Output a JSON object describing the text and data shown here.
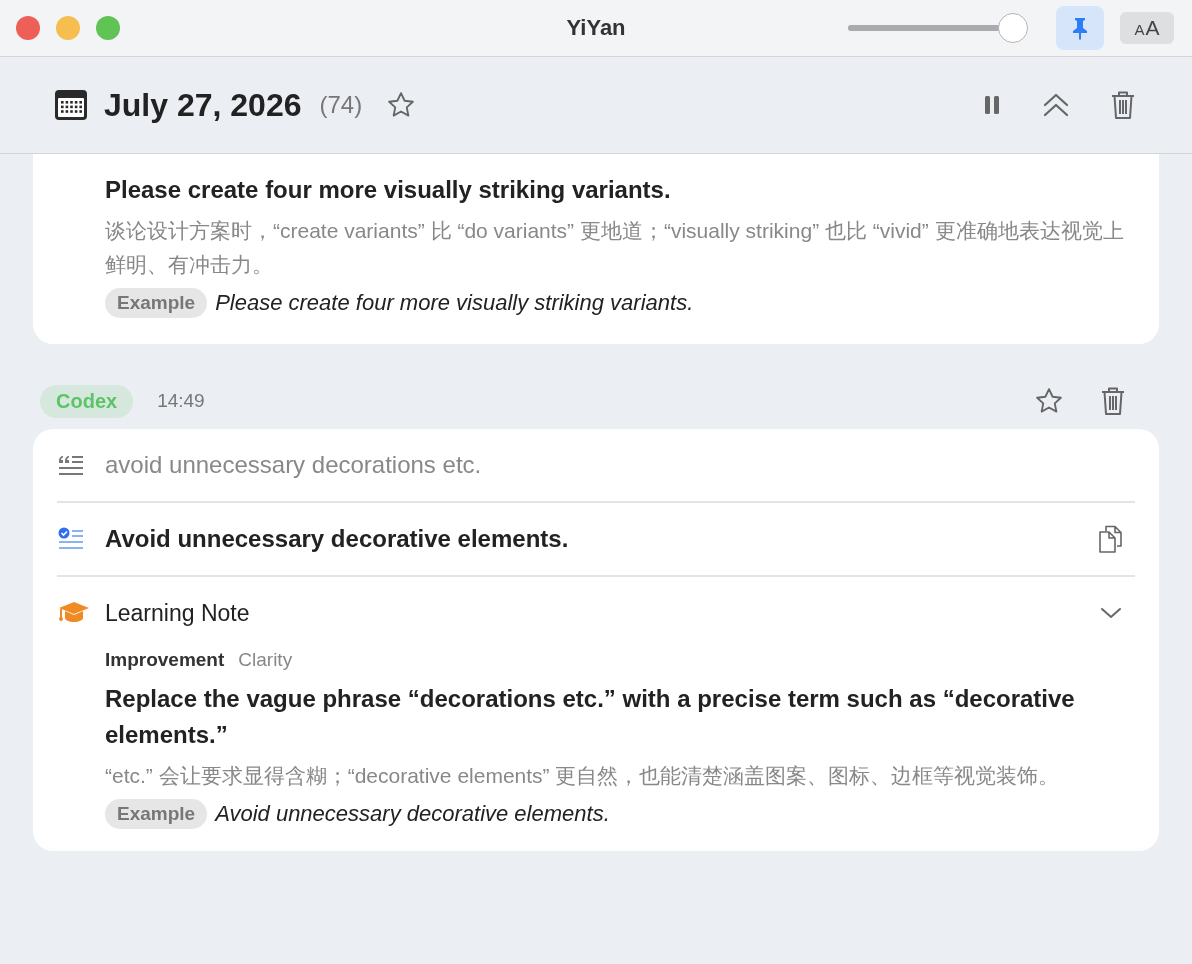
{
  "window": {
    "title": "YiYan"
  },
  "toolbar": {
    "slider": {
      "level": 0.94
    },
    "pin": {
      "on": true
    },
    "font_button": {
      "small": "A",
      "large": "A"
    }
  },
  "header": {
    "date": "July 27, 2026",
    "count": "(74)",
    "starred": false
  },
  "clipped_card": {
    "suggestion": "Please create four more visually striking variants.",
    "explanation": "谈论设计方案时，“create variants” 比 “do variants” 更地道；“visually striking” 也比 “vivid” 更准确地表达视觉上鲜明、有冲击力。",
    "example_label": "Example",
    "example": "Please create four more visually striking variants."
  },
  "entries": [
    {
      "source": "Codex",
      "color": "#5cc466",
      "time": "14:49",
      "starred": false,
      "original": "avoid unnecessary decorations etc.",
      "corrected": "Avoid unnecessary decorative elements.",
      "note": {
        "title": "Learning Note",
        "expanded": true,
        "type": "Improvement",
        "category": "Clarity",
        "suggestion": "Replace the vague phrase “decorations etc.” with a precise term such as “decorative elements.”",
        "explanation": "“etc.” 会让要求显得含糊；“decorative elements” 更自然，也能清楚涵盖图案、图标、边框等视觉装饰。",
        "example_label": "Example",
        "example": "Avoid unnecessary decorative elements."
      }
    }
  ]
}
